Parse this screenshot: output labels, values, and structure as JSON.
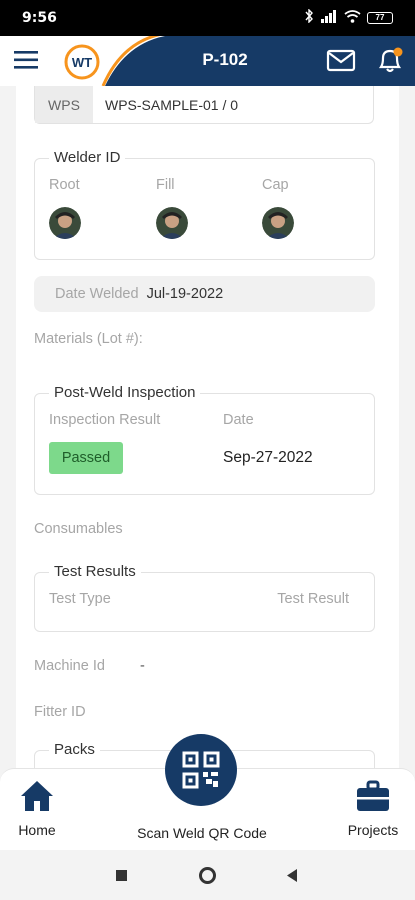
{
  "status_bar": {
    "time": "9:56",
    "battery": "77"
  },
  "header": {
    "title": "P-102",
    "notification_dot_color": "#f7941d",
    "brand_color": "#163a66"
  },
  "wps": {
    "label": "WPS",
    "value": "WPS-SAMPLE-01 / 0"
  },
  "welder_id": {
    "legend": "Welder ID",
    "columns": [
      {
        "label": "Root"
      },
      {
        "label": "Fill"
      },
      {
        "label": "Cap"
      }
    ]
  },
  "date_welded": {
    "label": "Date Welded",
    "value": "Jul-19-2022"
  },
  "materials": {
    "label": "Materials (Lot #):"
  },
  "post_weld_inspection": {
    "legend": "Post-Weld Inspection",
    "result_header": "Inspection Result",
    "date_header": "Date",
    "result": "Passed",
    "date": "Sep-27-2022",
    "passed_color": "#7dd98b"
  },
  "consumables": {
    "label": "Consumables"
  },
  "test_results": {
    "legend": "Test Results",
    "type_header": "Test Type",
    "result_header": "Test Result"
  },
  "machine": {
    "label": "Machine Id",
    "value": "-"
  },
  "fitter": {
    "label": "Fitter ID"
  },
  "packs": {
    "legend": "Packs"
  },
  "bottom_nav": {
    "home": "Home",
    "scan": "Scan Weld QR Code",
    "projects": "Projects"
  }
}
